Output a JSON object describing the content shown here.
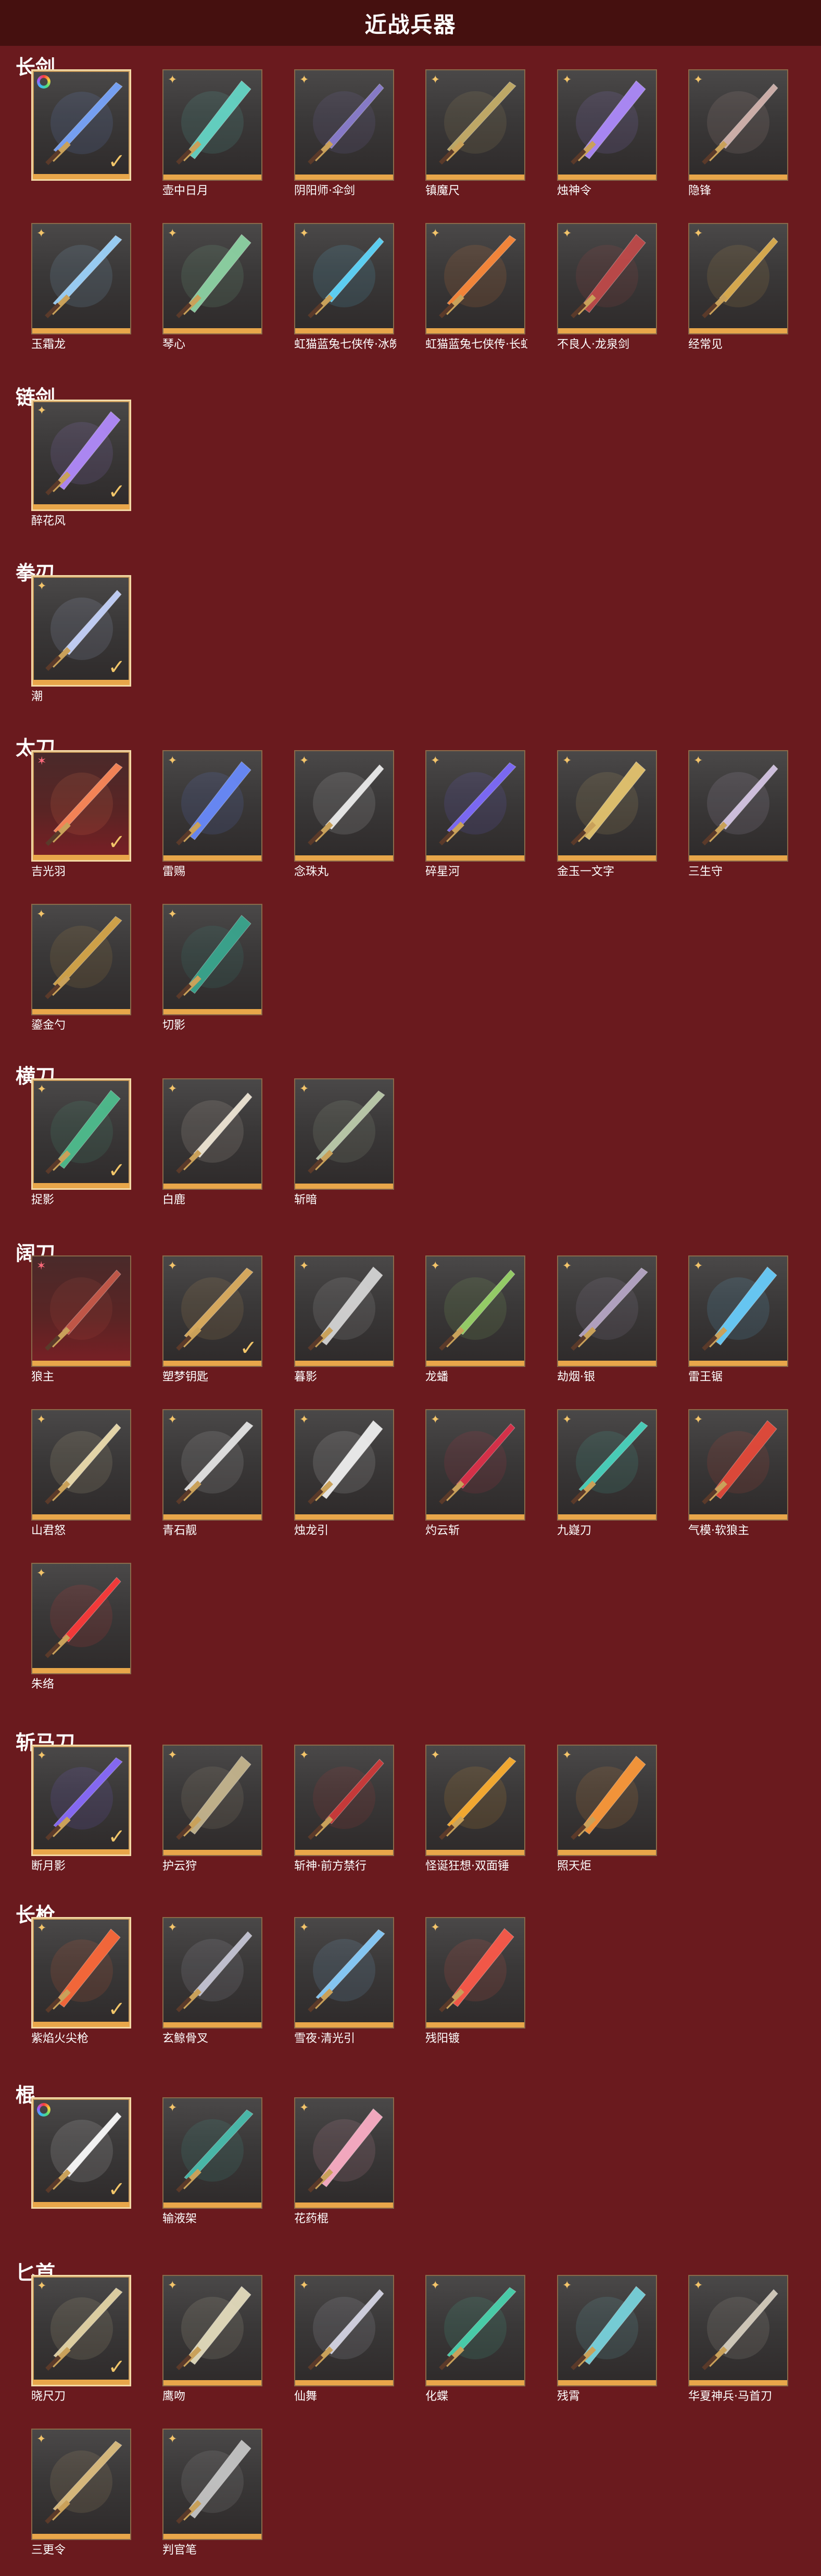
{
  "title": "近战兵器",
  "colors": {
    "background": "#6a1a1e",
    "header_bg": "#45100f",
    "tile_border": "#8a6a4a",
    "tile_bottom_bar": "#e8a64a",
    "check": "#f2c66a",
    "rank_gold": "#f3c46a",
    "rank_red": "#ff6b7c"
  },
  "sections": [
    {
      "title": "长剑",
      "items": [
        {
          "label": "",
          "rank": "rainbow",
          "checked": true,
          "selected": true,
          "icon": "blue-sword-icon",
          "tint": "#7aa7ff"
        },
        {
          "label": "壶中日月",
          "rank": "gold",
          "checked": false,
          "selected": false,
          "icon": "teal-sword-icon",
          "tint": "#66d9c9"
        },
        {
          "label": "阴阳师·伞剑",
          "rank": "gold",
          "checked": false,
          "selected": false,
          "icon": "umbrella-sword-icon",
          "tint": "#8c7fd1"
        },
        {
          "label": "镇魔尺",
          "rank": "gold",
          "checked": false,
          "selected": false,
          "icon": "dark-sword-icon",
          "tint": "#c8b06a"
        },
        {
          "label": "烛神令",
          "rank": "gold",
          "checked": false,
          "selected": false,
          "icon": "purple-sword-icon",
          "tint": "#b08cff"
        },
        {
          "label": "隐锋",
          "rank": "gold",
          "checked": false,
          "selected": false,
          "icon": "plain-sword-icon",
          "tint": "#d6b6b0"
        },
        {
          "label": "玉霜龙",
          "rank": "gold",
          "checked": false,
          "selected": false,
          "icon": "ice-sword-icon",
          "tint": "#9fd6ff"
        },
        {
          "label": "琴心",
          "rank": "gold",
          "checked": false,
          "selected": false,
          "icon": "jade-sword-icon",
          "tint": "#8fd6a6"
        },
        {
          "label": "虹猫蓝兔七侠传·冰魄",
          "rank": "gold",
          "checked": false,
          "selected": false,
          "icon": "cyan-sword-icon",
          "tint": "#5fd9ff"
        },
        {
          "label": "虹猫蓝兔七侠传·长虹",
          "rank": "gold",
          "checked": false,
          "selected": false,
          "icon": "flame-sword-icon",
          "tint": "#ff8a3a"
        },
        {
          "label": "不良人·龙泉剑",
          "rank": "gold",
          "checked": false,
          "selected": false,
          "icon": "crimson-sword-icon",
          "tint": "#c24a4a"
        },
        {
          "label": "经常见",
          "rank": "gold",
          "checked": false,
          "selected": false,
          "icon": "gold-sword-icon",
          "tint": "#e0b050"
        }
      ]
    },
    {
      "title": "链剑",
      "items": [
        {
          "label": "醉花风",
          "rank": "gold",
          "checked": true,
          "selected": true,
          "icon": "chain-sword-icon",
          "tint": "#b48cff"
        }
      ]
    },
    {
      "title": "拳刃",
      "items": [
        {
          "label": "潮",
          "rank": "gold",
          "checked": true,
          "selected": true,
          "icon": "claw-blade-icon",
          "tint": "#c8d6ff"
        }
      ]
    },
    {
      "title": "太刀",
      "items": [
        {
          "label": "吉光羽",
          "rank": "red",
          "checked": true,
          "selected": true,
          "icon": "red-katana-icon",
          "tint": "#ff8a5a"
        },
        {
          "label": "雷赐",
          "rank": "gold",
          "checked": false,
          "selected": false,
          "icon": "thunder-katana-icon",
          "tint": "#6a8cff"
        },
        {
          "label": "念珠丸",
          "rank": "gold",
          "checked": false,
          "selected": false,
          "icon": "white-katana-icon",
          "tint": "#f0f0f0"
        },
        {
          "label": "碎星河",
          "rank": "gold",
          "checked": false,
          "selected": false,
          "icon": "violet-katana-icon",
          "tint": "#7f6cff"
        },
        {
          "label": "金玉一文字",
          "rank": "gold",
          "checked": false,
          "selected": false,
          "icon": "gold-katana-icon",
          "tint": "#e8c770"
        },
        {
          "label": "三生守",
          "rank": "gold",
          "checked": false,
          "selected": false,
          "icon": "silver-katana-icon",
          "tint": "#d8c8e8"
        },
        {
          "label": "鎏金勺",
          "rank": "gold",
          "checked": false,
          "selected": false,
          "icon": "spoon-icon",
          "tint": "#d8a84a"
        },
        {
          "label": "切影",
          "rank": "gold",
          "checked": false,
          "selected": false,
          "icon": "shadow-katana-icon",
          "tint": "#3aa890"
        }
      ]
    },
    {
      "title": "横刀",
      "items": [
        {
          "label": "捉影",
          "rank": "gold",
          "checked": true,
          "selected": true,
          "icon": "green-saber-icon",
          "tint": "#4fc090"
        },
        {
          "label": "白鹿",
          "rank": "gold",
          "checked": false,
          "selected": false,
          "icon": "white-saber-icon",
          "tint": "#f3ead8"
        },
        {
          "label": "斩暗",
          "rank": "gold",
          "checked": false,
          "selected": false,
          "icon": "dark-saber-icon",
          "tint": "#bfcfae"
        }
      ]
    },
    {
      "title": "阔刀",
      "items": [
        {
          "label": "狼主",
          "rank": "red",
          "checked": false,
          "selected": false,
          "icon": "wolf-blade-icon",
          "tint": "#c85a4a"
        },
        {
          "label": "塑梦钥匙",
          "rank": "gold",
          "checked": true,
          "selected": false,
          "icon": "key-blade-icon",
          "tint": "#e0b060"
        },
        {
          "label": "暮影",
          "rank": "gold",
          "checked": false,
          "selected": false,
          "icon": "dusk-blade-icon",
          "tint": "#d8d8d8"
        },
        {
          "label": "龙蟠",
          "rank": "gold",
          "checked": false,
          "selected": false,
          "icon": "dragon-blade-icon",
          "tint": "#9ad66a"
        },
        {
          "label": "劫烟·银",
          "rank": "gold",
          "checked": false,
          "selected": false,
          "icon": "smoke-blade-icon",
          "tint": "#b8a8c8"
        },
        {
          "label": "雷王锯",
          "rank": "gold",
          "checked": false,
          "selected": false,
          "icon": "thunder-saw-icon",
          "tint": "#6ad0ff"
        },
        {
          "label": "山君怒",
          "rank": "gold",
          "checked": false,
          "selected": false,
          "icon": "tiger-blade-icon",
          "tint": "#f0e0b0"
        },
        {
          "label": "青石靓",
          "rank": "gold",
          "checked": false,
          "selected": false,
          "icon": "stone-blade-icon",
          "tint": "#e8e8e8"
        },
        {
          "label": "烛龙引",
          "rank": "gold",
          "checked": false,
          "selected": false,
          "icon": "torch-dragon-icon",
          "tint": "#f3f3f3"
        },
        {
          "label": "灼云斩",
          "rank": "gold",
          "checked": false,
          "selected": false,
          "icon": "scorch-blade-icon",
          "tint": "#e0304a"
        },
        {
          "label": "九嶷刀",
          "rank": "gold",
          "checked": false,
          "selected": false,
          "icon": "nine-peak-blade-icon",
          "tint": "#4ad6c0"
        },
        {
          "label": "气模·软狼主",
          "rank": "gold",
          "checked": false,
          "selected": false,
          "icon": "inflatable-blade-icon",
          "tint": "#e84a3a"
        },
        {
          "label": "朱络",
          "rank": "gold",
          "checked": false,
          "selected": false,
          "icon": "vermilion-blade-icon",
          "tint": "#ff3a3a"
        }
      ]
    },
    {
      "title": "斩马刀",
      "items": [
        {
          "label": "断月影",
          "rank": "gold",
          "checked": true,
          "selected": true,
          "icon": "moon-glaive-icon",
          "tint": "#8a6cff"
        },
        {
          "label": "护云狩",
          "rank": "gold",
          "checked": false,
          "selected": false,
          "icon": "cloud-glaive-icon",
          "tint": "#c8b890"
        },
        {
          "label": "斩神·前方禁行",
          "rank": "gold",
          "checked": false,
          "selected": false,
          "icon": "sign-glaive-icon",
          "tint": "#d03a3a"
        },
        {
          "label": "怪诞狂想·双面锤",
          "rank": "gold",
          "checked": false,
          "selected": false,
          "icon": "hammer-icon",
          "tint": "#ffb030"
        },
        {
          "label": "照天炬",
          "rank": "gold",
          "checked": false,
          "selected": false,
          "icon": "torch-glaive-icon",
          "tint": "#ff9a3a"
        }
      ]
    },
    {
      "title": "长枪",
      "items": [
        {
          "label": "紫焰火尖枪",
          "rank": "gold",
          "checked": true,
          "selected": true,
          "icon": "fire-spear-icon",
          "tint": "#ff6a3a"
        },
        {
          "label": "玄鲸骨叉",
          "rank": "gold",
          "checked": false,
          "selected": false,
          "icon": "bone-trident-icon",
          "tint": "#c8c8d8"
        },
        {
          "label": "雪夜·清光引",
          "rank": "gold",
          "checked": false,
          "selected": false,
          "icon": "snow-spear-icon",
          "tint": "#8ad0ff"
        },
        {
          "label": "残阳镀",
          "rank": "gold",
          "checked": false,
          "selected": false,
          "icon": "sunset-spear-icon",
          "tint": "#ff5a4a"
        }
      ]
    },
    {
      "title": "棍",
      "items": [
        {
          "label": "",
          "rank": "rainbow",
          "checked": true,
          "selected": true,
          "icon": "light-staff-icon",
          "tint": "#ffffff"
        },
        {
          "label": "输液架",
          "rank": "gold",
          "checked": false,
          "selected": false,
          "icon": "iv-stand-icon",
          "tint": "#4ac0b0"
        },
        {
          "label": "花药棍",
          "rank": "gold",
          "checked": false,
          "selected": false,
          "icon": "flower-staff-icon",
          "tint": "#ffb0c8"
        }
      ]
    },
    {
      "title": "匕首",
      "items": [
        {
          "label": "晓尺刀",
          "rank": "gold",
          "checked": true,
          "selected": true,
          "icon": "dawn-dagger-icon",
          "tint": "#e8d8a8"
        },
        {
          "label": "鹰吻",
          "rank": "gold",
          "checked": false,
          "selected": false,
          "icon": "eagle-dagger-icon",
          "tint": "#e8e0c0"
        },
        {
          "label": "仙舞",
          "rank": "gold",
          "checked": false,
          "selected": false,
          "icon": "dance-dagger-icon",
          "tint": "#d8d8e8"
        },
        {
          "label": "化蝶",
          "rank": "gold",
          "checked": false,
          "selected": false,
          "icon": "butterfly-dagger-icon",
          "tint": "#4ad6b0"
        },
        {
          "label": "残霄",
          "rank": "gold",
          "checked": false,
          "selected": false,
          "icon": "sky-dagger-icon",
          "tint": "#7ad6e0"
        },
        {
          "label": "华夏神兵·马首刀",
          "rank": "gold",
          "checked": false,
          "selected": false,
          "icon": "horse-dagger-icon",
          "tint": "#d8d0c0"
        },
        {
          "label": "三更令",
          "rank": "gold",
          "checked": false,
          "selected": false,
          "icon": "night-dagger-icon",
          "tint": "#e0c080"
        },
        {
          "label": "判官笔",
          "rank": "gold",
          "checked": false,
          "selected": false,
          "icon": "judge-brush-icon",
          "tint": "#c8c8c8"
        }
      ]
    }
  ]
}
